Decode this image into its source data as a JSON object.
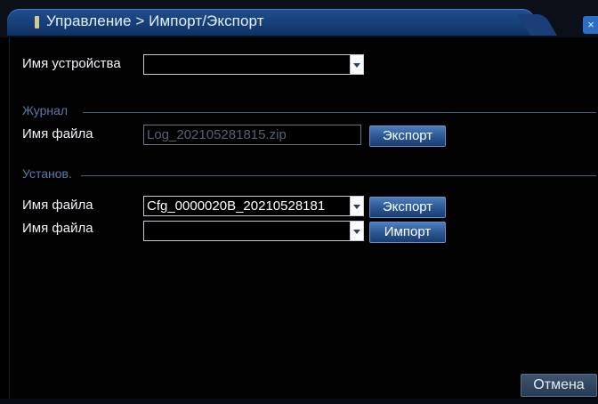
{
  "window": {
    "title": "Управление > Импорт/Экспорт",
    "close_label": "×"
  },
  "device": {
    "label": "Имя устройства",
    "value": ""
  },
  "journal": {
    "section_title": "Журнал",
    "file_label": "Имя файла",
    "file_value": "Log_202105281815.zip",
    "export_label": "Экспорт"
  },
  "settings": {
    "section_title": "Установ.",
    "export_row": {
      "file_label": "Имя файла",
      "file_value": "Cfg_0000020B_20210528181",
      "export_label": "Экспорт"
    },
    "import_row": {
      "file_label": "Имя файла",
      "file_value": "",
      "import_label": "Импорт"
    }
  },
  "footer": {
    "cancel_label": "Отмена"
  }
}
